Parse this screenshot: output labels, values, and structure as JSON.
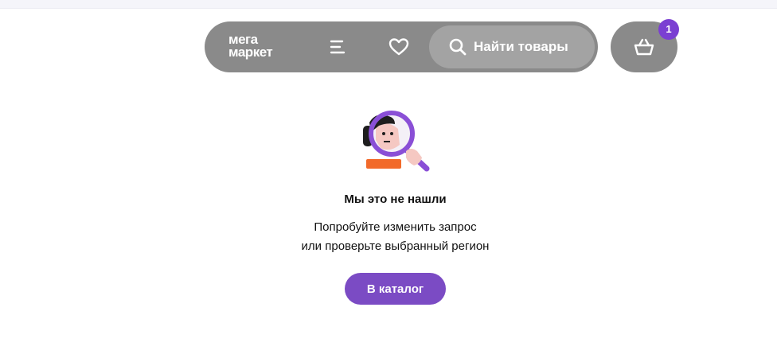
{
  "header": {
    "logo_line1": "мега",
    "logo_line2": "маркет",
    "search_label": "Найти товары",
    "cart_badge": "1",
    "accent_color": "#7b3fd2",
    "header_color": "#8a8a8a"
  },
  "icons": {
    "menu": "menu-icon",
    "favorites": "heart-icon",
    "search": "search-icon",
    "cart": "basket-icon"
  },
  "empty_state": {
    "title": "Мы это не нашли",
    "line1": "Попробуйте изменить запрос",
    "line2": "или проверьте выбранный регион",
    "button_label": "В каталог",
    "button_color": "#7b4bc4"
  }
}
